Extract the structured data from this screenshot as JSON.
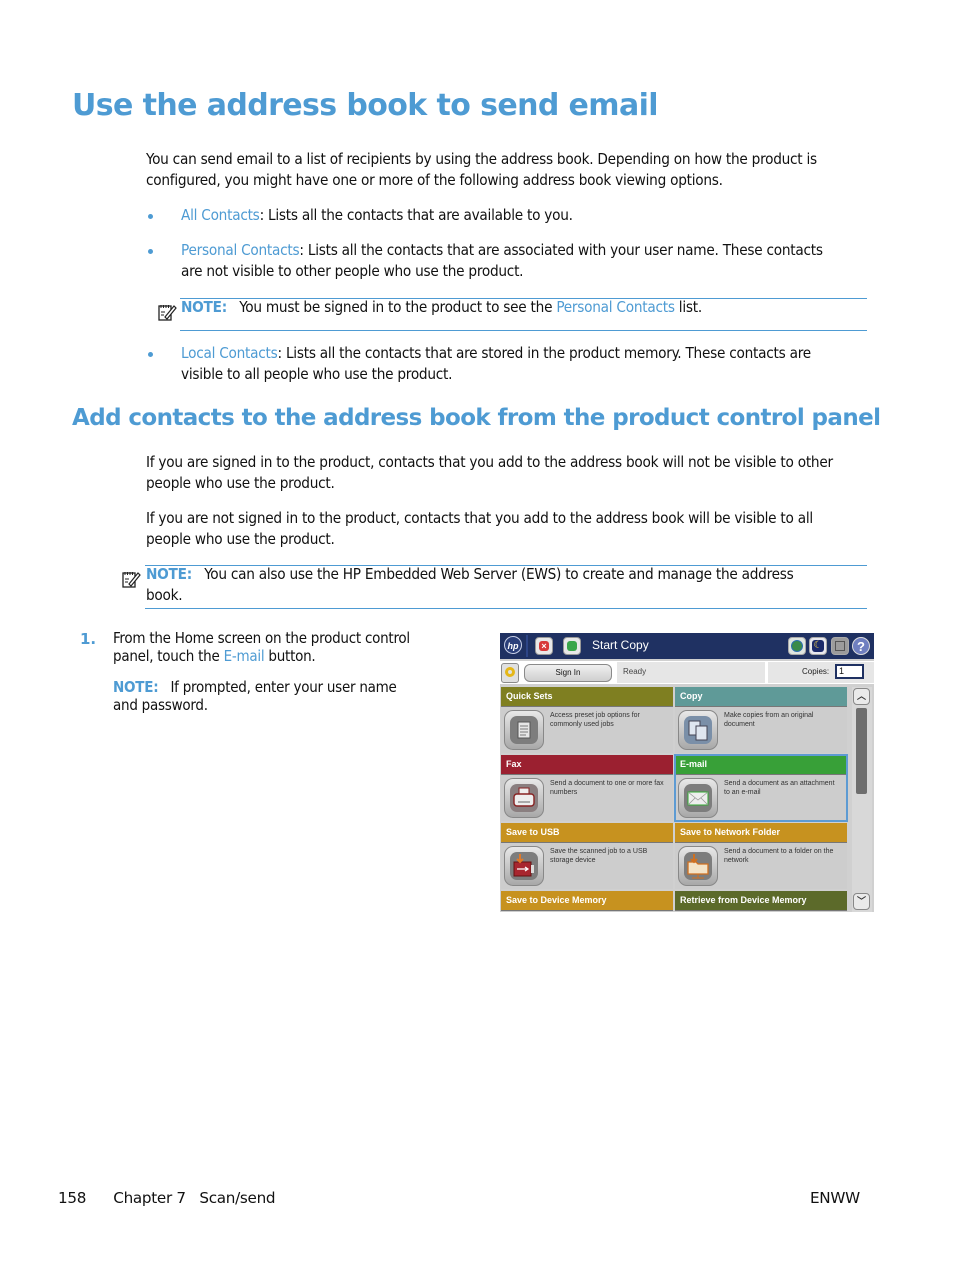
{
  "page": {
    "title": "Use the address book to send email",
    "intro": "You can send email to a list of recipients by using the address book. Depending on how the product is configured, you might have one or more of the following address book viewing options.",
    "options": [
      {
        "link": "All Contacts",
        "text_line1": ": Lists all the contacts that are available to you.",
        "text_line2": ""
      },
      {
        "link": "Personal Contacts",
        "text_line1": ": Lists all the contacts that are associated with your user name. These contacts",
        "text_line2": "are not visible to other people who use the product."
      },
      {
        "link": "Local Contacts",
        "text_line1": ": Lists all the contacts that are stored in the product memory. These contacts are",
        "text_line2": "visible to all people who use the product."
      }
    ],
    "note1": {
      "label": "NOTE:",
      "text_before": "You must be signed in to the product to see the ",
      "link": "Personal Contacts",
      "text_after": " list."
    },
    "section_title": "Add contacts to the address book from the product control panel",
    "para1_line1": "If you are signed in to the product, contacts that you add to the address book will not be visible to other",
    "para1_line2": "people who use the product.",
    "para2_line1": "If you are not signed in to the product, contacts that you add to the address book will be visible to all",
    "para2_line2": "people who use the product.",
    "note2": {
      "label": "NOTE:",
      "line1": "You can also use the HP Embedded Web Server (EWS) to create and manage the address",
      "line2": "book."
    },
    "step1": {
      "number": "1.",
      "line1": "From the Home screen on the product control",
      "line2_before": "panel, touch the ",
      "line2_link": "E-mail",
      "line2_after": " button.",
      "note_label": "NOTE:",
      "note_line1": "If prompted, enter your user name",
      "note_line2": "and password."
    },
    "footer": {
      "page_number": "158",
      "chapter": "Chapter 7",
      "section": "Scan/send",
      "right": "ENWW"
    }
  },
  "control_panel": {
    "logo": "hp",
    "start_label": "Start Copy",
    "sign_in": "Sign In",
    "status": "Ready",
    "copies_label": "Copies:",
    "copies_value": "1",
    "help_glyph": "?",
    "stop_glyph": "×",
    "tiles": [
      {
        "title": "Quick Sets",
        "desc": "Access preset job options for commonly used jobs",
        "color": "#7f7f21",
        "icon": "clipboard-icon"
      },
      {
        "title": "Copy",
        "desc": "Make copies from an original document",
        "color": "#5f9a98",
        "icon": "copy-documents-icon"
      },
      {
        "title": "Fax",
        "desc": "Send a document to one or more fax numbers",
        "color": "#9b2030",
        "icon": "fax-printer-icon"
      },
      {
        "title": "E-mail",
        "desc": "Send a document as an attachment to an e-mail",
        "color": "#38a038",
        "icon": "envelope-icon"
      },
      {
        "title": "Save to USB",
        "desc": "Save the scanned job to a USB storage device",
        "color": "#c7921f",
        "icon": "usb-icon"
      },
      {
        "title": "Save to Network Folder",
        "desc": "Send a document to a folder on the network",
        "color": "#c7921f",
        "icon": "network-folder-icon"
      },
      {
        "title": "Save to Device Memory",
        "desc": "",
        "color": "#c7921f",
        "icon": ""
      },
      {
        "title": "Retrieve from Device Memory",
        "desc": "",
        "color": "#5c6a2a",
        "icon": ""
      }
    ]
  }
}
